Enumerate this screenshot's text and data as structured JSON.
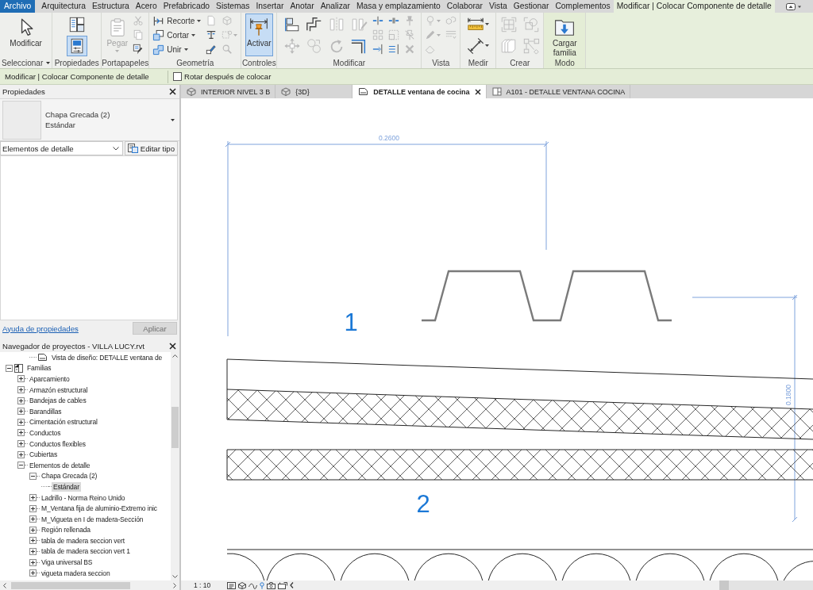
{
  "ribbon_tabs": [
    {
      "label": "Archivo",
      "kind": "file",
      "selected": false
    },
    {
      "label": "Arquitectura",
      "kind": "tab",
      "selected": false
    },
    {
      "label": "Estructura",
      "kind": "tab",
      "selected": false
    },
    {
      "label": "Acero",
      "kind": "tab",
      "selected": false
    },
    {
      "label": "Prefabricado",
      "kind": "tab",
      "selected": false
    },
    {
      "label": "Sistemas",
      "kind": "tab",
      "selected": false
    },
    {
      "label": "Insertar",
      "kind": "tab",
      "selected": false
    },
    {
      "label": "Anotar",
      "kind": "tab",
      "selected": false
    },
    {
      "label": "Analizar",
      "kind": "tab",
      "selected": false
    },
    {
      "label": "Masa y emplazamiento",
      "kind": "tab",
      "selected": false
    },
    {
      "label": "Colaborar",
      "kind": "tab",
      "selected": false
    },
    {
      "label": "Vista",
      "kind": "tab",
      "selected": false
    },
    {
      "label": "Gestionar",
      "kind": "tab",
      "selected": false
    },
    {
      "label": "Complementos",
      "kind": "tab",
      "selected": false
    },
    {
      "label": "Modificar | Colocar Componente de detalle",
      "kind": "tab",
      "selected": true
    }
  ],
  "ribbon_panels": [
    {
      "label": "Seleccionar",
      "dropdown": true,
      "contextual": false,
      "tools": [
        {
          "kind": "large",
          "label": "Modificar",
          "disabled": false,
          "dropdown": false
        }
      ]
    },
    {
      "label": "Propiedades",
      "dropdown": false,
      "contextual": false,
      "tools": [
        {
          "kind": "medium",
          "disabled": false,
          "dropdown": false,
          "selected": false
        },
        {
          "kind": "medium",
          "disabled": false,
          "dropdown": false,
          "selected": true
        }
      ]
    },
    {
      "label": "Portapapeles",
      "dropdown": false,
      "contextual": false,
      "tools": [
        {
          "kind": "large",
          "label": "Pegar",
          "disabled": true,
          "dropdown": true
        },
        {
          "kind": "small",
          "disabled": true,
          "dropdown": false
        },
        {
          "kind": "small",
          "disabled": true,
          "dropdown": false
        },
        {
          "kind": "small",
          "disabled": false,
          "dropdown": false
        }
      ]
    },
    {
      "label": "Geometría",
      "dropdown": false,
      "contextual": false,
      "tools": [
        {
          "kind": "labeled",
          "label": "Recorte",
          "disabled": false,
          "dropdown": true
        },
        {
          "kind": "labeled",
          "label": "Cortar",
          "disabled": false,
          "dropdown": true
        },
        {
          "kind": "labeled",
          "label": "Unir",
          "disabled": false,
          "dropdown": true
        },
        {
          "kind": "small",
          "disabled": true,
          "dropdown": false
        },
        {
          "kind": "small",
          "disabled": false,
          "dropdown": false
        },
        {
          "kind": "small",
          "disabled": false,
          "dropdown": false
        },
        {
          "kind": "small",
          "disabled": true,
          "dropdown": false
        },
        {
          "kind": "small",
          "disabled": true,
          "dropdown": true
        },
        {
          "kind": "small",
          "disabled": true,
          "dropdown": false
        }
      ]
    },
    {
      "label": "Controles",
      "dropdown": false,
      "contextual": false,
      "tools": [
        {
          "kind": "large",
          "label": "Activar",
          "disabled": false,
          "dropdown": false,
          "selected": true
        }
      ]
    },
    {
      "label": "Modificar",
      "dropdown": false,
      "contextual": false,
      "tools": [
        {
          "kind": "medium",
          "disabled": false,
          "dropdown": false
        },
        {
          "kind": "medium",
          "disabled": true,
          "dropdown": false
        },
        {
          "kind": "medium",
          "disabled": false,
          "dropdown": false
        },
        {
          "kind": "medium",
          "disabled": true,
          "dropdown": false
        },
        {
          "kind": "medium",
          "disabled": true,
          "dropdown": false
        },
        {
          "kind": "medium",
          "disabled": true,
          "dropdown": false
        },
        {
          "kind": "medium",
          "disabled": true,
          "dropdown": false
        },
        {
          "kind": "medium",
          "disabled": false,
          "dropdown": false
        },
        {
          "kind": "small",
          "disabled": false,
          "dropdown": false
        },
        {
          "kind": "small",
          "disabled": true,
          "dropdown": false
        },
        {
          "kind": "small",
          "disabled": false,
          "dropdown": false
        },
        {
          "kind": "small",
          "disabled": false,
          "dropdown": false
        },
        {
          "kind": "small",
          "disabled": true,
          "dropdown": false
        },
        {
          "kind": "small",
          "disabled": false,
          "dropdown": false
        },
        {
          "kind": "small",
          "disabled": true,
          "dropdown": false
        },
        {
          "kind": "small",
          "disabled": true,
          "dropdown": false
        },
        {
          "kind": "small",
          "disabled": true,
          "dropdown": false
        }
      ]
    },
    {
      "label": "Vista",
      "dropdown": false,
      "contextual": false,
      "tools": [
        {
          "kind": "small",
          "disabled": true,
          "dropdown": true
        },
        {
          "kind": "small",
          "disabled": true,
          "dropdown": true
        },
        {
          "kind": "small",
          "disabled": true,
          "dropdown": false
        },
        {
          "kind": "small",
          "disabled": true,
          "dropdown": false
        },
        {
          "kind": "small",
          "disabled": true,
          "dropdown": false
        }
      ]
    },
    {
      "label": "Medir",
      "dropdown": false,
      "contextual": false,
      "tools": [
        {
          "kind": "medium",
          "disabled": false,
          "dropdown": true
        },
        {
          "kind": "medium",
          "disabled": false,
          "dropdown": true
        }
      ]
    },
    {
      "label": "Crear",
      "dropdown": false,
      "contextual": false,
      "tools": [
        {
          "kind": "medium",
          "disabled": true,
          "dropdown": false
        },
        {
          "kind": "medium",
          "disabled": true,
          "dropdown": false
        },
        {
          "kind": "medium",
          "disabled": true,
          "dropdown": false
        },
        {
          "kind": "medium",
          "disabled": true,
          "dropdown": false
        }
      ]
    },
    {
      "label": "Modo",
      "dropdown": false,
      "contextual": true,
      "tools": [
        {
          "kind": "large",
          "label": "Cargar familia",
          "disabled": false,
          "dropdown": false
        }
      ]
    }
  ],
  "options_bar": {
    "mode": "Modificar | Colocar Componente de detalle",
    "rotate_after_placing": {
      "label": "Rotar después de colocar",
      "checked": false
    }
  },
  "properties": {
    "title": "Propiedades",
    "type_name": "Chapa Grecada (2)",
    "type_variant": "Estándar",
    "category": "Elementos de detalle",
    "edit_type": "Editar tipo",
    "help_link": "Ayuda de propiedades",
    "apply": {
      "label": "Aplicar",
      "disabled": true
    }
  },
  "project_browser": {
    "title": "Navegador de proyectos - VILLA LUCY.rvt",
    "continued_items": [
      {
        "label": "Vista de diseño: DETALLE ventana de",
        "kind": "view",
        "selected": false
      }
    ],
    "items": [
      {
        "label": "Familias",
        "kind": "group",
        "expanded": true,
        "selected": false,
        "children": [
          {
            "label": "Aparcamiento",
            "expanded": false,
            "selected": false
          },
          {
            "label": "Armazón estructural",
            "expanded": false,
            "selected": false
          },
          {
            "label": "Bandejas de cables",
            "expanded": false,
            "selected": false
          },
          {
            "label": "Barandillas",
            "expanded": false,
            "selected": false
          },
          {
            "label": "Cimentación estructural",
            "expanded": false,
            "selected": false
          },
          {
            "label": "Conductos",
            "expanded": false,
            "selected": false
          },
          {
            "label": "Conductos flexibles",
            "expanded": false,
            "selected": false
          },
          {
            "label": "Cubiertas",
            "expanded": false,
            "selected": false
          },
          {
            "label": "Elementos de detalle",
            "expanded": true,
            "selected": false,
            "children": [
              {
                "label": "Chapa Grecada (2)",
                "expanded": true,
                "selected": false,
                "children": [
                  {
                    "label": "Estándar",
                    "selected": true
                  }
                ]
              },
              {
                "label": "Ladrillo - Norma Reino Unido",
                "expanded": false,
                "selected": false
              },
              {
                "label": "M_Ventana fija de aluminio-Extremo inic",
                "expanded": false,
                "selected": false
              },
              {
                "label": "M_Vigueta en I de madera-Sección",
                "expanded": false,
                "selected": false
              },
              {
                "label": "Región rellenada",
                "expanded": false,
                "selected": false
              },
              {
                "label": "tabla de madera seccion vert",
                "expanded": false,
                "selected": false
              },
              {
                "label": "tabla de madera seccion vert 1",
                "expanded": false,
                "selected": false
              },
              {
                "label": "Viga universal BS",
                "expanded": false,
                "selected": false
              },
              {
                "label": "vigueta madera seccion",
                "expanded": false,
                "selected": false
              }
            ]
          }
        ]
      }
    ]
  },
  "view_tabs": [
    {
      "label": "INTERIOR NIVEL 3 B",
      "kind": "model",
      "selected": false
    },
    {
      "label": "{3D}",
      "kind": "model",
      "selected": false
    },
    {
      "label": "DETALLE ventana de cocina",
      "kind": "drafting",
      "selected": true
    },
    {
      "label": "A101 - DETALLE VENTANA COCINA",
      "kind": "sheet",
      "selected": false
    }
  ],
  "drawing": {
    "horizontal_dimension": "0.2600",
    "vertical_dimension": "0.1800",
    "detail_numbers": [
      "1",
      "2"
    ]
  },
  "status_bar": {
    "scale": "1 : 10"
  }
}
